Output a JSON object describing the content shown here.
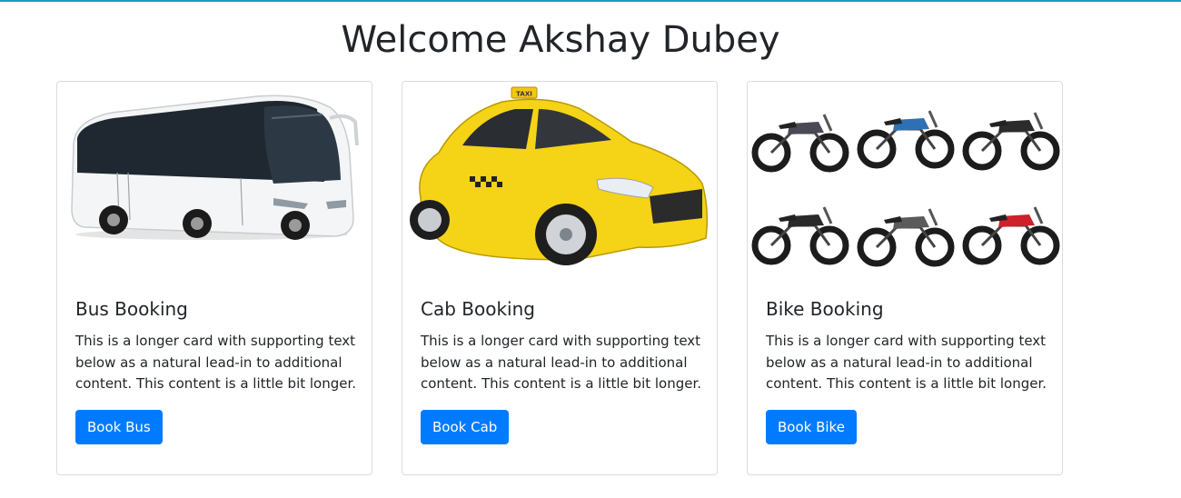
{
  "header": {
    "title": "Welcome Akshay Dubey"
  },
  "cards": [
    {
      "title": "Bus Booking",
      "text": "This is a longer card with supporting text below as a natural lead-in to additional content. This content is a little bit longer.",
      "button": "Book Bus",
      "image": "bus-image"
    },
    {
      "title": "Cab Booking",
      "text": "This is a longer card with supporting text below as a natural lead-in to additional content. This content is a little bit longer.",
      "button": "Book Cab",
      "image": "taxi-image",
      "image_sign_text": "TAXI"
    },
    {
      "title": "Bike Booking",
      "text": "This is a longer card with supporting text below as a natural lead-in to additional content. This content is a little bit longer.",
      "button": "Book Bike",
      "image": "bikes-collage-image"
    }
  ],
  "colors": {
    "accent": "#007bff",
    "top_rule": "#17a2b8",
    "taxi_yellow": "#f5d316",
    "bike_red": "#d0202a",
    "bike_blue": "#2f6fb3"
  }
}
